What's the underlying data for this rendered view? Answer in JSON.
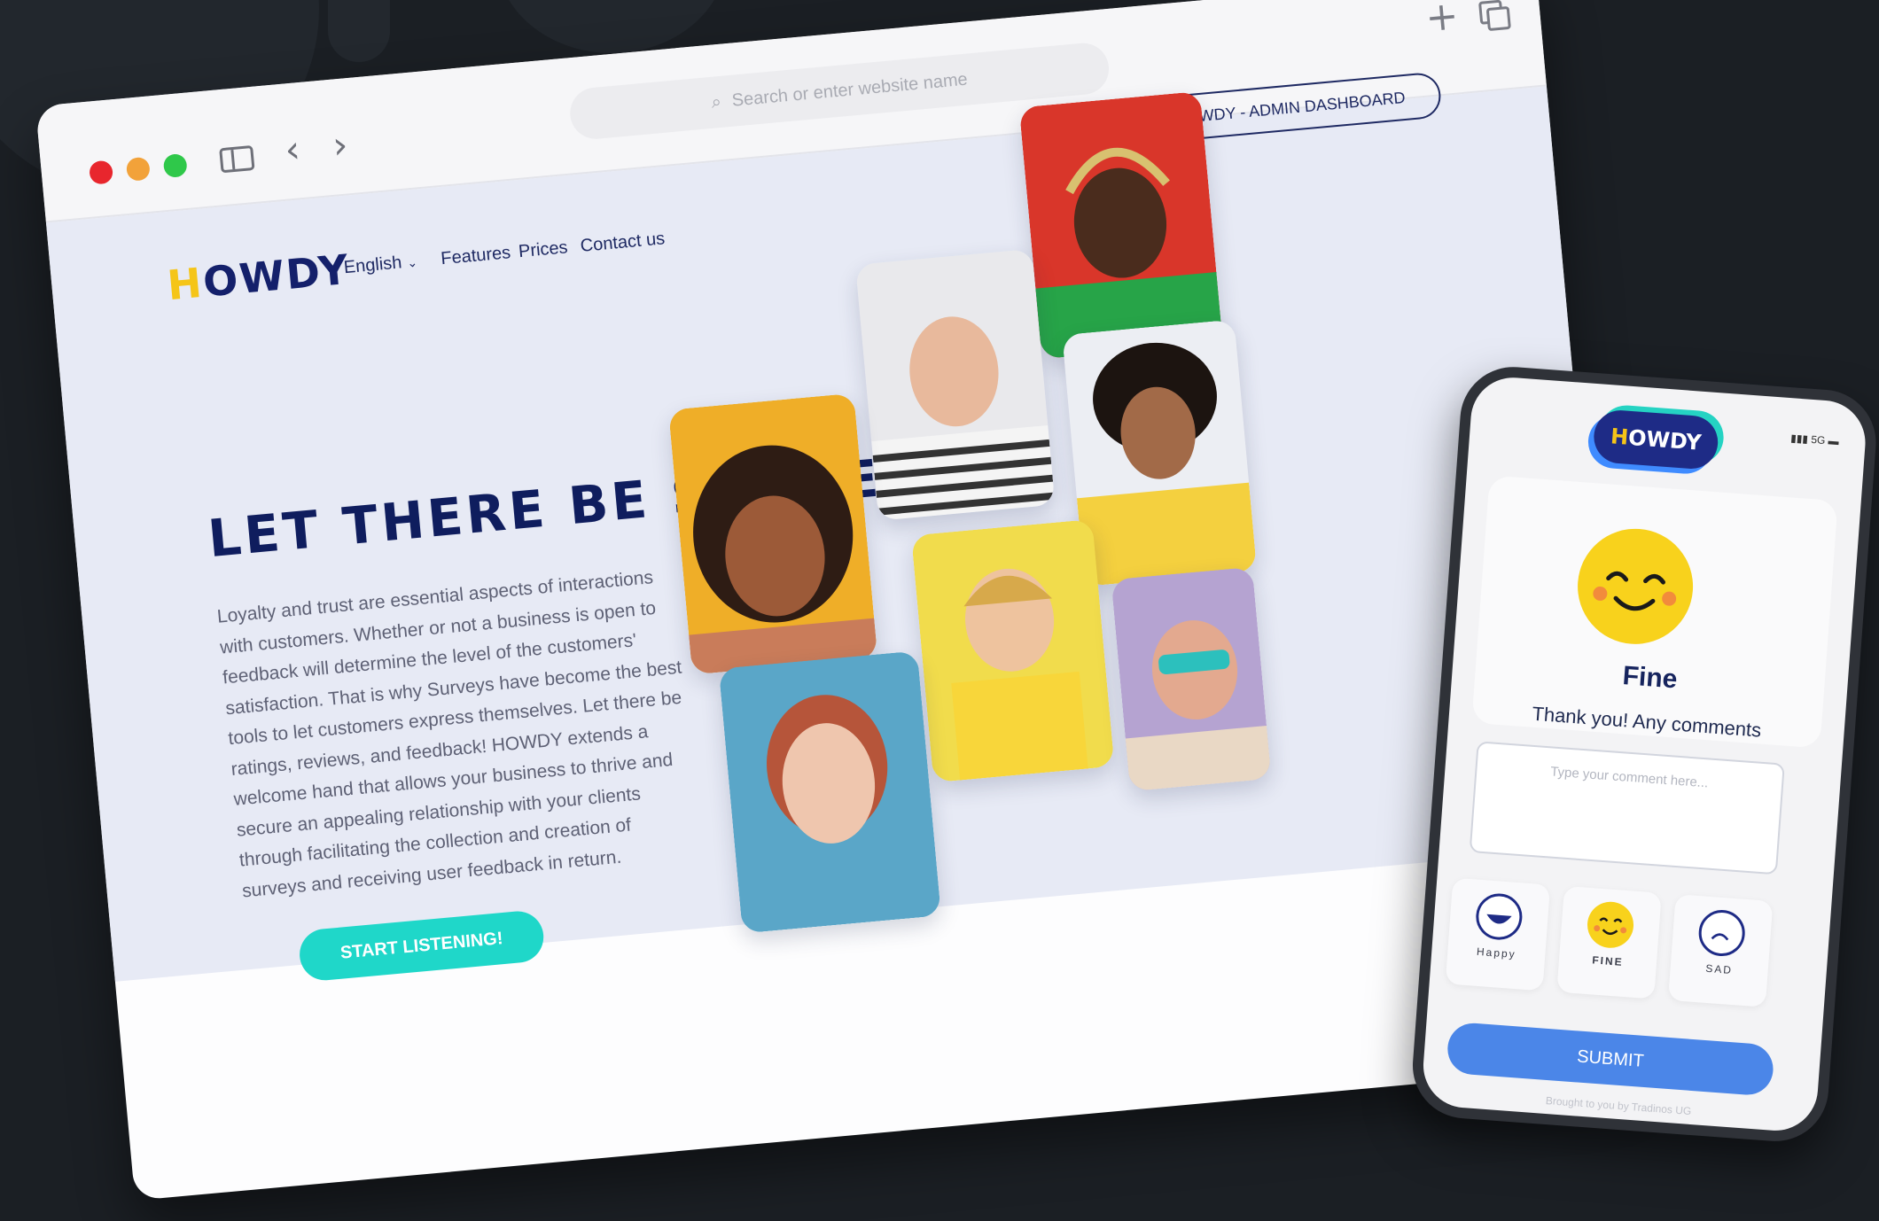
{
  "browser": {
    "address_placeholder": "Search or enter website name"
  },
  "site": {
    "logo": "HOWDY",
    "nav": {
      "language": "English",
      "features": "Features",
      "prices": "Prices",
      "contact": "Contact us"
    },
    "admin_button": "HOWDY - ADMIN DASHBOARD",
    "headline": "LET THERE BE SURVEYS!",
    "body": "Loyalty and trust are essential aspects of interactions with customers. Whether or not a business is open to feedback will determine the level of the customers' satisfaction. That is why Surveys have become the best tools to let customers express themselves. Let there be ratings, reviews, and feedback! HOWDY extends a welcome hand that allows your business to thrive and secure an appealing relationship with your clients through facilitating the collection and creation of surveys and receiving user feedback in return.",
    "cta": "START LISTENING!"
  },
  "phone": {
    "logo": "HOWDY",
    "status": "5G",
    "mood": "Fine",
    "prompt": "Thank you! Any comments",
    "comment_placeholder": "Type your comment here...",
    "options": [
      "Happy",
      "FINE",
      "SAD"
    ],
    "submit": "SUBMIT",
    "credit": "Brought to you by Tradinos UG"
  },
  "colors": {
    "accent": "#1fd7c9",
    "navy": "#0f1d5e",
    "logo_yellow": "#f5c518",
    "submit_blue": "#4b86e8",
    "dot_red": "#e8262d",
    "dot_orange": "#f2a23a",
    "dot_green": "#2fc84a"
  }
}
